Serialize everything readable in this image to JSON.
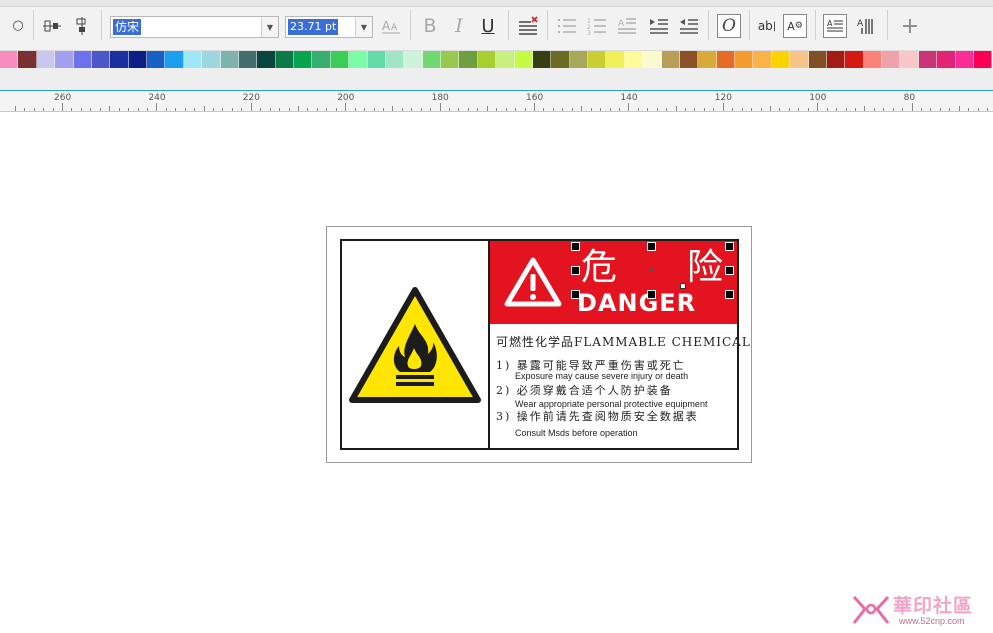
{
  "toolbar": {
    "font_name": "仿宋",
    "font_size": "23.71 pt",
    "bold": "B",
    "italic": "I",
    "underline": "U",
    "ab_label": "ab",
    "a_label": "A",
    "add": "+"
  },
  "palette": {
    "colors": [
      "#f98cbf",
      "#7a3030",
      "#c9c6f1",
      "#a39ff0",
      "#6e71ee",
      "#4d57c8",
      "#1a2fa0",
      "#0b1f85",
      "#1760c6",
      "#1aa0ee",
      "#9de7f6",
      "#9ed6df",
      "#7fb1ad",
      "#436e6d",
      "#0a4640",
      "#0b7a46",
      "#0aa34f",
      "#35b070",
      "#3ccc5a",
      "#7dfca7",
      "#62dba9",
      "#a0e5c6",
      "#cdf4d8",
      "#72d872",
      "#98c94c",
      "#6e9e40",
      "#a6d030",
      "#c8f07e",
      "#c4fc43",
      "#363f13",
      "#6b6b23",
      "#a8a858",
      "#c9ce33",
      "#f0f05a",
      "#fffb9a",
      "#fbf9ce",
      "#b99e5a",
      "#8a5027",
      "#d9a93a",
      "#e56c24",
      "#f59a2c",
      "#fbb347",
      "#fcd200",
      "#f6c487",
      "#815024",
      "#a41b16",
      "#d61813",
      "#fa8279",
      "#f0a2ab",
      "#f9c7c7",
      "#c83475",
      "#e32374",
      "#f92d95",
      "#fc0055"
    ]
  },
  "ruler": {
    "labels": [
      "260",
      "240",
      "220",
      "200",
      "180",
      "160",
      "140",
      "120",
      "100",
      "80"
    ]
  },
  "sign": {
    "title_cn_1": "危",
    "title_cn_2": "险",
    "title_en": "DANGER",
    "hazard_line": "可燃性化学品FLAMMABLE CHEMICAL",
    "items": [
      {
        "cn": "1) 暴露可能导致严重伤害或死亡",
        "en": "Exposure may cause severe injury or death"
      },
      {
        "cn": "2) 必须穿戴合适个人防护装备",
        "en": "Wear appropriate personal protective equipment"
      },
      {
        "cn": "3) 操作前请先查阅物质安全数据表",
        "en": "Consult Msds before operation"
      }
    ],
    "colors": {
      "banner": "#e3141f",
      "warning_yellow": "#ffe600",
      "frame": "#1c1c1c"
    }
  },
  "icons": {
    "warning": "warning-triangle-icon",
    "fire": "flame-icon"
  },
  "watermark": {
    "name": "華印社區",
    "url": "www.52cnp.com"
  }
}
